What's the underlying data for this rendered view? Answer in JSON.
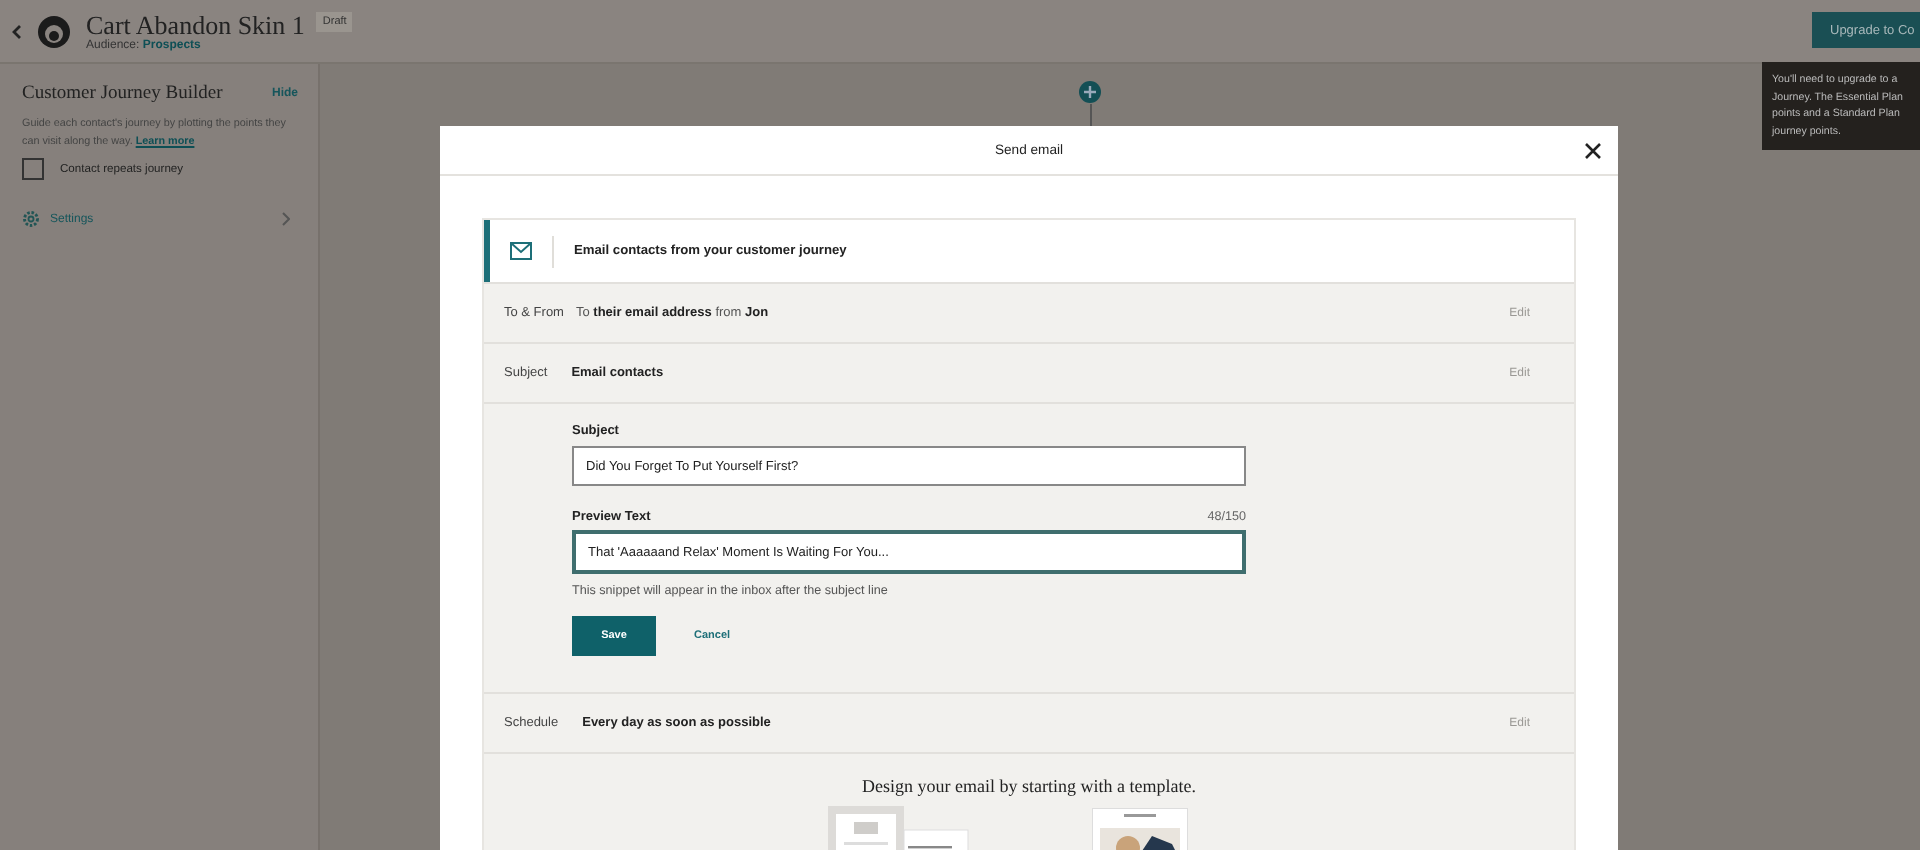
{
  "header": {
    "title": "Cart Abandon Skin 1",
    "audience_label": "Audience:",
    "audience": "Prospects",
    "badge": "Draft",
    "upgrade_button": "Upgrade to Co"
  },
  "tooltip": {
    "lines": [
      "You'll need to upgrade to a",
      "Journey. The Essential Plan",
      "points and a Standard Plan",
      "journey points."
    ]
  },
  "sidebar": {
    "title": "Customer Journey Builder",
    "hide": "Hide",
    "description": "Guide each contact's journey by plotting the points they can visit along the way.",
    "learn_more": "Learn more",
    "checkbox": {
      "label": "Contact repeats journey",
      "checked": false
    },
    "settings": "Settings"
  },
  "modal": {
    "title": "Send email",
    "intro": "Email contacts from your customer journey",
    "rows": [
      {
        "kind": "mixed",
        "label": "To & From",
        "value": "To **their email address** from **Jon**",
        "edit": "Edit"
      },
      {
        "kind": "bold",
        "label": "Subject",
        "value": "Email contacts",
        "edit": "Edit"
      }
    ],
    "form": {
      "subject_label": "Subject",
      "subject_value": "Did You Forget To Put Yourself First?",
      "preview_label": "Preview Text",
      "counter": "48/150",
      "preview_value": "That 'Aaaaaand Relax' Moment Is Waiting For You...",
      "hint": "This snippet will appear in the inbox after the subject line",
      "save": "Save",
      "cancel": "Cancel"
    },
    "schedule": {
      "kind": "bold",
      "label": "Schedule",
      "value": "Every day as soon as possible",
      "edit": "Edit"
    },
    "design_heading": "Design your email by starting with a template."
  }
}
